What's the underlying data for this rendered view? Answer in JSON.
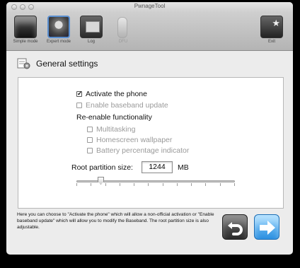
{
  "window": {
    "title": "PwnageTool"
  },
  "toolbar": {
    "items": [
      {
        "label": "Simple mode",
        "icon": "simple-mode-icon",
        "enabled": true
      },
      {
        "label": "Expert mode",
        "icon": "expert-mode-icon",
        "enabled": true,
        "selected": true
      },
      {
        "label": "Log",
        "icon": "log-icon",
        "enabled": true
      },
      {
        "label": "DFU",
        "icon": "dfu-icon",
        "enabled": false
      },
      {
        "label": "Exit",
        "icon": "exit-icon",
        "enabled": true
      }
    ]
  },
  "section": {
    "title": "General settings",
    "icon": "settings-gear-icon"
  },
  "settings": {
    "activate_phone": {
      "label": "Activate the phone",
      "checked": true,
      "enabled": true
    },
    "enable_baseband": {
      "label": "Enable baseband update",
      "checked": false,
      "enabled": false
    },
    "reenable_heading": "Re-enable functionality",
    "multitasking": {
      "label": "Multitasking",
      "checked": false,
      "enabled": false
    },
    "homescreen_wallpaper": {
      "label": "Homescreen wallpaper",
      "checked": false,
      "enabled": false
    },
    "battery_percentage": {
      "label": "Battery percentage indicator",
      "checked": false,
      "enabled": false
    }
  },
  "partition": {
    "label": "Root partition size:",
    "value": "1244",
    "unit": "MB",
    "slider_fraction": 0.14
  },
  "help_text": "Here you can choose to \"Activate the phone\" which will allow a non-official activation or \"Enable baseband update\" which will allow you to modify the Baseband. The root partition size is also adjustable.",
  "navigation": {
    "back_icon": "back-arrow-icon",
    "next_icon": "next-arrow-icon"
  },
  "colors": {
    "accent": "#2b8fe0",
    "selection": "#5a8fd0"
  }
}
